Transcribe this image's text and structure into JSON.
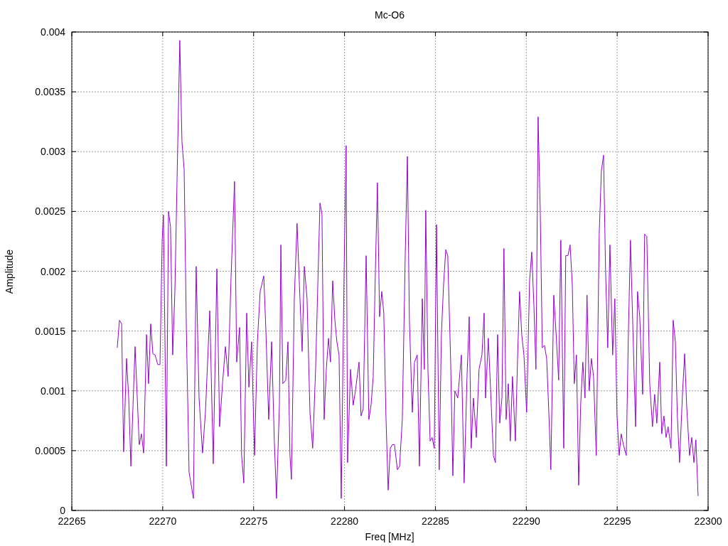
{
  "chart_data": {
    "type": "line",
    "grid": true,
    "title": "Mc-O6",
    "xlabel": "Freq [MHz]",
    "ylabel": "Amplitude",
    "xlim": [
      22265,
      22300
    ],
    "ylim": [
      0,
      0.004
    ],
    "xticks": [
      22265,
      22270,
      22275,
      22280,
      22285,
      22290,
      22295,
      22300
    ],
    "yticks": [
      0,
      0.0005,
      0.001,
      0.0015,
      0.002,
      0.0025,
      0.003,
      0.0035,
      0.004
    ],
    "x": [
      22267.5,
      22267.62,
      22267.74,
      22267.85,
      22268.01,
      22268.13,
      22268.25,
      22268.48,
      22268.71,
      22268.83,
      22268.95,
      22269.11,
      22269.22,
      22269.34,
      22269.46,
      22269.58,
      22269.73,
      22269.85,
      22269.97,
      22270.04,
      22270.12,
      22270.2,
      22270.32,
      22270.43,
      22270.55,
      22270.67,
      22270.83,
      22270.94,
      22271.06,
      22271.18,
      22271.3,
      22271.45,
      22271.69,
      22271.84,
      22272.0,
      22272.19,
      22272.35,
      22272.59,
      22272.78,
      22272.98,
      22273.13,
      22273.29,
      22273.45,
      22273.6,
      22273.76,
      22273.95,
      22274.07,
      22274.23,
      22274.34,
      22274.46,
      22274.62,
      22274.74,
      22274.89,
      22275.05,
      22275.21,
      22275.36,
      22275.56,
      22275.67,
      22275.83,
      22275.99,
      22276.14,
      22276.26,
      22276.42,
      22276.5,
      22276.61,
      22276.77,
      22276.89,
      22277.0,
      22277.08,
      22277.24,
      22277.39,
      22277.55,
      22277.67,
      22277.79,
      22277.94,
      22278.1,
      22278.25,
      22278.41,
      22278.65,
      22278.76,
      22278.88,
      22279.0,
      22279.12,
      22279.23,
      22279.35,
      22279.47,
      22279.58,
      22279.7,
      22279.82,
      22279.98,
      22280.09,
      22280.17,
      22280.33,
      22280.48,
      22280.6,
      22280.8,
      22280.91,
      22281.03,
      22281.19,
      22281.34,
      22281.46,
      22281.58,
      22281.7,
      22281.81,
      22281.93,
      22282.05,
      22282.16,
      22282.28,
      22282.4,
      22282.52,
      22282.63,
      22282.75,
      22282.91,
      22283.03,
      22283.18,
      22283.34,
      22283.46,
      22283.57,
      22283.73,
      22283.85,
      22284.0,
      22284.12,
      22284.28,
      22284.39,
      22284.47,
      22284.59,
      22284.71,
      22284.82,
      22284.94,
      22285.06,
      22285.21,
      22285.33,
      22285.45,
      22285.57,
      22285.68,
      22285.84,
      22285.96,
      22286.07,
      22286.23,
      22286.43,
      22286.58,
      22286.74,
      22286.86,
      22286.97,
      22287.09,
      22287.25,
      22287.4,
      22287.56,
      22287.68,
      22287.76,
      22287.91,
      22288.03,
      22288.19,
      22288.3,
      22288.42,
      22288.54,
      22288.66,
      22288.77,
      22288.89,
      22289.01,
      22289.12,
      22289.24,
      22289.4,
      22289.52,
      22289.63,
      22289.75,
      22289.87,
      22290.02,
      22290.18,
      22290.3,
      22290.42,
      22290.53,
      22290.65,
      22290.77,
      22290.88,
      22291.0,
      22291.12,
      22291.24,
      22291.35,
      22291.51,
      22291.63,
      22291.78,
      22291.9,
      22292.06,
      22292.17,
      22292.29,
      22292.41,
      22292.53,
      22292.64,
      22292.76,
      22292.88,
      22292.99,
      22293.11,
      22293.23,
      22293.34,
      22293.46,
      22293.58,
      22293.7,
      22293.85,
      22294.01,
      22294.13,
      22294.25,
      22294.36,
      22294.48,
      22294.6,
      22294.75,
      22294.87,
      22294.99,
      22295.11,
      22295.22,
      22295.34,
      22295.5,
      22295.61,
      22295.73,
      22295.85,
      22296.01,
      22296.12,
      22296.24,
      22296.4,
      22296.51,
      22296.63,
      22296.79,
      22296.94,
      22297.06,
      22297.18,
      22297.34,
      22297.45,
      22297.57,
      22297.69,
      22297.8,
      22297.96,
      22298.08,
      22298.2,
      22298.31,
      22298.43,
      22298.59,
      22298.71,
      22298.82,
      22298.98,
      22299.1,
      22299.22,
      22299.33,
      22299.45
    ],
    "series": [
      {
        "color": "#9400d3",
        "values": [
          0.00136,
          0.00159,
          0.00156,
          0.00049,
          0.00127,
          0.00094,
          0.00037,
          0.00137,
          0.00055,
          0.00064,
          0.00048,
          0.00147,
          0.00106,
          0.00156,
          0.00131,
          0.0013,
          0.00122,
          0.00122,
          0.00226,
          0.00247,
          0.00147,
          0.00037,
          0.0025,
          0.00237,
          0.0013,
          0.00183,
          0.00308,
          0.00393,
          0.00308,
          0.00285,
          0.00153,
          0.00032,
          0.0001,
          0.00204,
          0.00094,
          0.00048,
          0.00082,
          0.00167,
          0.00039,
          0.00202,
          0.0007,
          0.00106,
          0.00137,
          0.00112,
          0.00195,
          0.00275,
          0.00124,
          0.00153,
          0.00046,
          0.00023,
          0.00165,
          0.00103,
          0.00141,
          0.00046,
          0.00141,
          0.00183,
          0.00196,
          0.00153,
          0.00076,
          0.00141,
          0.00058,
          0.0001,
          0.00088,
          0.00222,
          0.00106,
          0.00109,
          0.00141,
          0.00046,
          0.00026,
          0.00177,
          0.0024,
          0.00177,
          0.00133,
          0.00204,
          0.00177,
          0.00082,
          0.00052,
          0.00118,
          0.00257,
          0.00248,
          0.00076,
          0.00118,
          0.00144,
          0.00124,
          0.00192,
          0.00159,
          0.00141,
          0.0013,
          0.0001,
          0.00201,
          0.00305,
          0.0004,
          0.00118,
          0.00088,
          0.001,
          0.00124,
          0.00079,
          0.00085,
          0.00213,
          0.00076,
          0.00088,
          0.00112,
          0.00201,
          0.00274,
          0.00162,
          0.00183,
          0.00165,
          0.00079,
          0.00017,
          0.00052,
          0.00055,
          0.00055,
          0.00034,
          0.00037,
          0.00076,
          0.00213,
          0.00296,
          0.00159,
          0.00082,
          0.00124,
          0.0013,
          0.00037,
          0.00177,
          0.00118,
          0.00251,
          0.00118,
          0.00058,
          0.00061,
          0.00052,
          0.00239,
          0.00034,
          0.00147,
          0.00189,
          0.00218,
          0.00213,
          0.00124,
          0.00029,
          0.001,
          0.00094,
          0.0013,
          0.00023,
          0.00112,
          0.00162,
          0.00052,
          0.00094,
          0.00061,
          0.00118,
          0.0013,
          0.00165,
          0.00094,
          0.00144,
          0.00103,
          0.00046,
          0.0004,
          0.00147,
          0.00073,
          0.00094,
          0.00219,
          0.00076,
          0.00106,
          0.00058,
          0.00112,
          0.00058,
          0.00127,
          0.00183,
          0.00147,
          0.0013,
          0.00082,
          0.00192,
          0.00216,
          0.00171,
          0.00118,
          0.00329,
          0.00248,
          0.00136,
          0.00138,
          0.00127,
          0.00082,
          0.00034,
          0.0018,
          0.0015,
          0.00109,
          0.00226,
          0.00052,
          0.00213,
          0.00213,
          0.00222,
          0.00189,
          0.00106,
          0.0013,
          0.00021,
          0.00088,
          0.00124,
          0.00094,
          0.0018,
          0.001,
          0.00127,
          0.00112,
          0.00046,
          0.00231,
          0.00284,
          0.00297,
          0.00201,
          0.00136,
          0.00222,
          0.0013,
          0.00177,
          0.00079,
          0.00046,
          0.00064,
          0.00055,
          0.00046,
          0.00144,
          0.00226,
          0.00159,
          0.0007,
          0.00183,
          0.00162,
          0.00097,
          0.00231,
          0.00229,
          0.00106,
          0.0007,
          0.00097,
          0.00073,
          0.00124,
          0.00064,
          0.00079,
          0.00061,
          0.0007,
          0.00052,
          0.00159,
          0.00141,
          0.00079,
          0.0004,
          0.00097,
          0.00131,
          0.00088,
          0.00046,
          0.00061,
          0.0004,
          0.00059,
          0.00012
        ]
      }
    ]
  }
}
